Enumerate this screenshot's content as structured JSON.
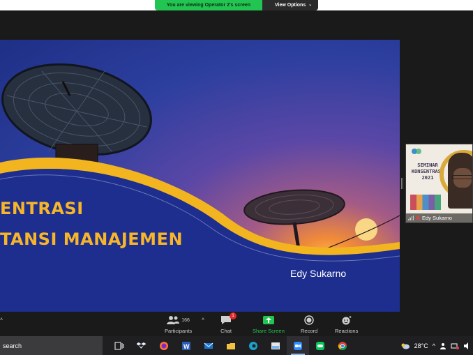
{
  "banner": {
    "message": "You are viewing Operator 2's screen",
    "view_options": "View Options"
  },
  "slide": {
    "title_line1": "ENTRASI",
    "title_line2": "TANSI MANAJEMEN",
    "presenter": "Edy Sukarno"
  },
  "participant_thumb": {
    "poster_line1": "SEMINAR",
    "poster_line2": "KONSENTRASI",
    "poster_line3": "2021",
    "name": "Edy Sukarno"
  },
  "controls": {
    "participants_label": "Participants",
    "participants_count": "166",
    "chat_label": "Chat",
    "chat_badge": "1",
    "share_label": "Share Screen",
    "record_label": "Record",
    "reactions_label": "Reactions"
  },
  "taskbar": {
    "search_text": "search",
    "temperature": "28°C",
    "icons": [
      "task-view-icon",
      "dropbox-icon",
      "firefox-icon",
      "word-icon",
      "mail-icon",
      "file-explorer-icon",
      "edge-icon",
      "image-app-icon",
      "zoom-icon",
      "line-icon",
      "chrome-icon"
    ]
  },
  "colors": {
    "share_green": "#23c552",
    "slide_gold": "#f7b52a",
    "badge_red": "#e02828"
  }
}
